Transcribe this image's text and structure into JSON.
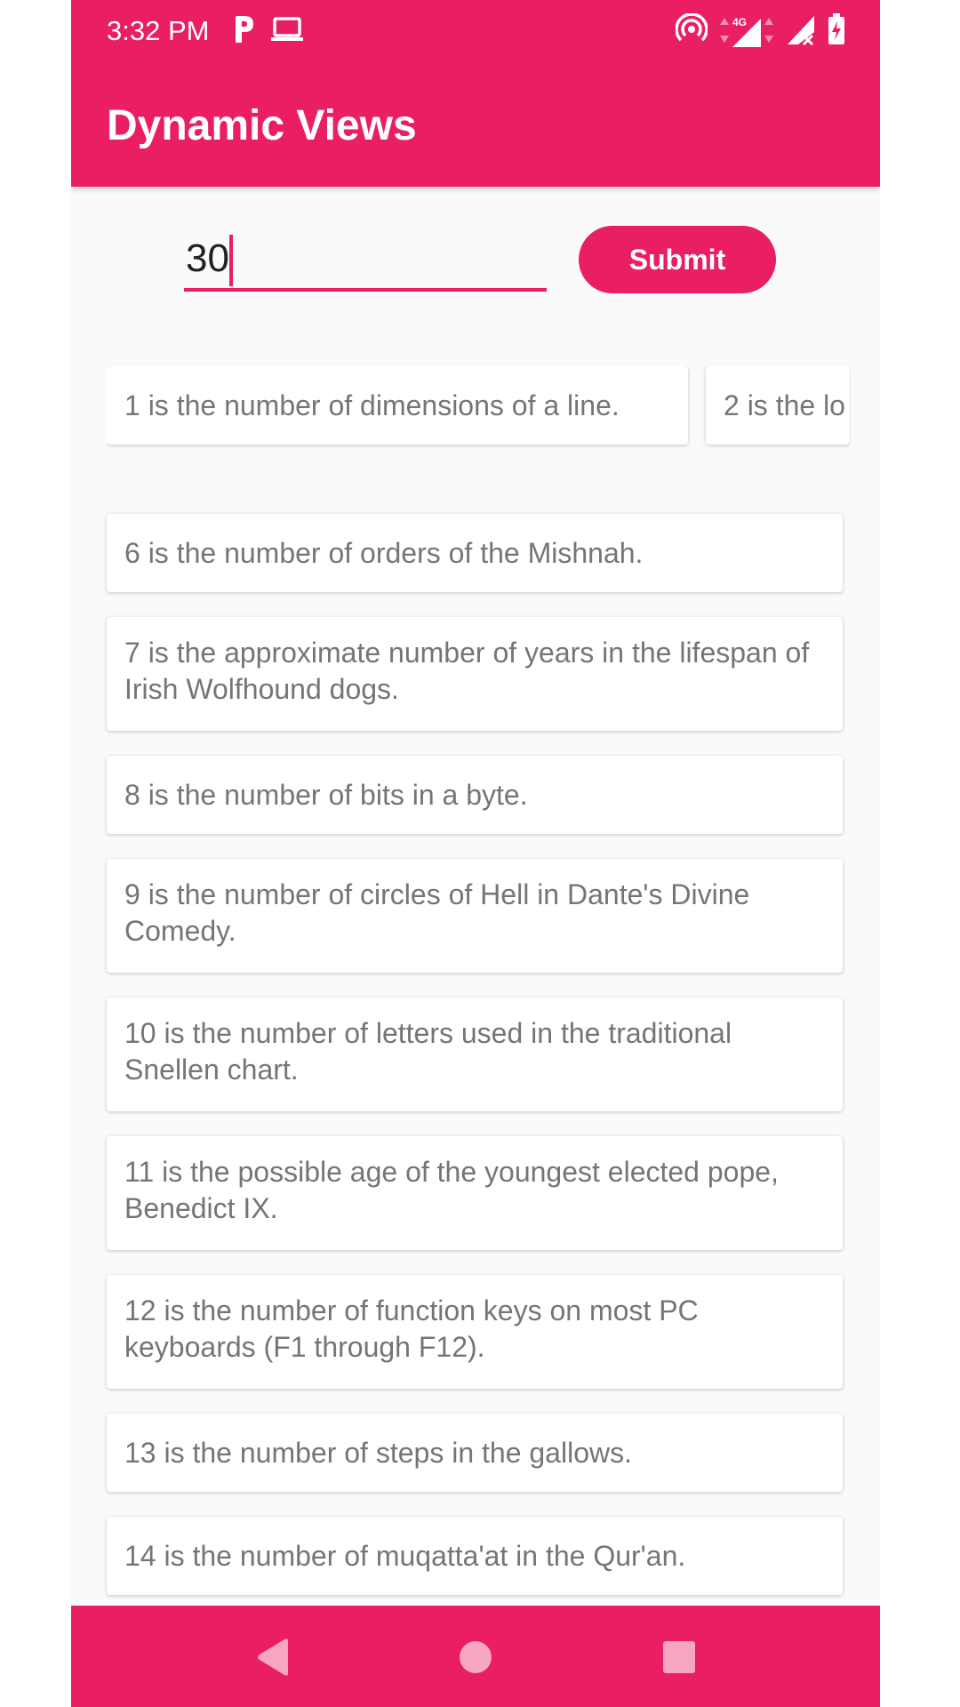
{
  "status_bar": {
    "time": "3:32 PM",
    "icons_left": [
      "parking-icon",
      "laptop-icon"
    ],
    "icons_right": [
      "hotspot-icon",
      "signal-4g-icon",
      "signal-no-sim-icon",
      "battery-charging-icon"
    ],
    "network_label": "4G"
  },
  "app_bar": {
    "title": "Dynamic Views"
  },
  "form": {
    "input_value": "30",
    "submit_label": "Submit"
  },
  "horizontal_items": [
    "1 is the number of dimensions of a line.",
    "2 is the lo"
  ],
  "list_items": [
    "6 is the number of orders of the Mishnah.",
    "7 is the approximate number of years in the lifespan of Irish Wolfhound dogs.",
    "8 is the number of bits in a byte.",
    "9 is the number of circles of Hell in Dante's Divine Comedy.",
    "10 is the number of letters used in the traditional Snellen chart.",
    "11 is the possible age of the youngest elected pope, Benedict IX.",
    "12 is the number of function keys on most PC keyboards (F1 through F12).",
    "13 is the number of steps in the gallows.",
    "14 is the number of muqatta'at in the Qur'an."
  ],
  "nav_bar": {
    "buttons": [
      "back-icon",
      "home-icon",
      "recents-icon"
    ]
  },
  "colors": {
    "primary": "#e91e63",
    "background": "#fafafa",
    "card_text": "#757575"
  }
}
